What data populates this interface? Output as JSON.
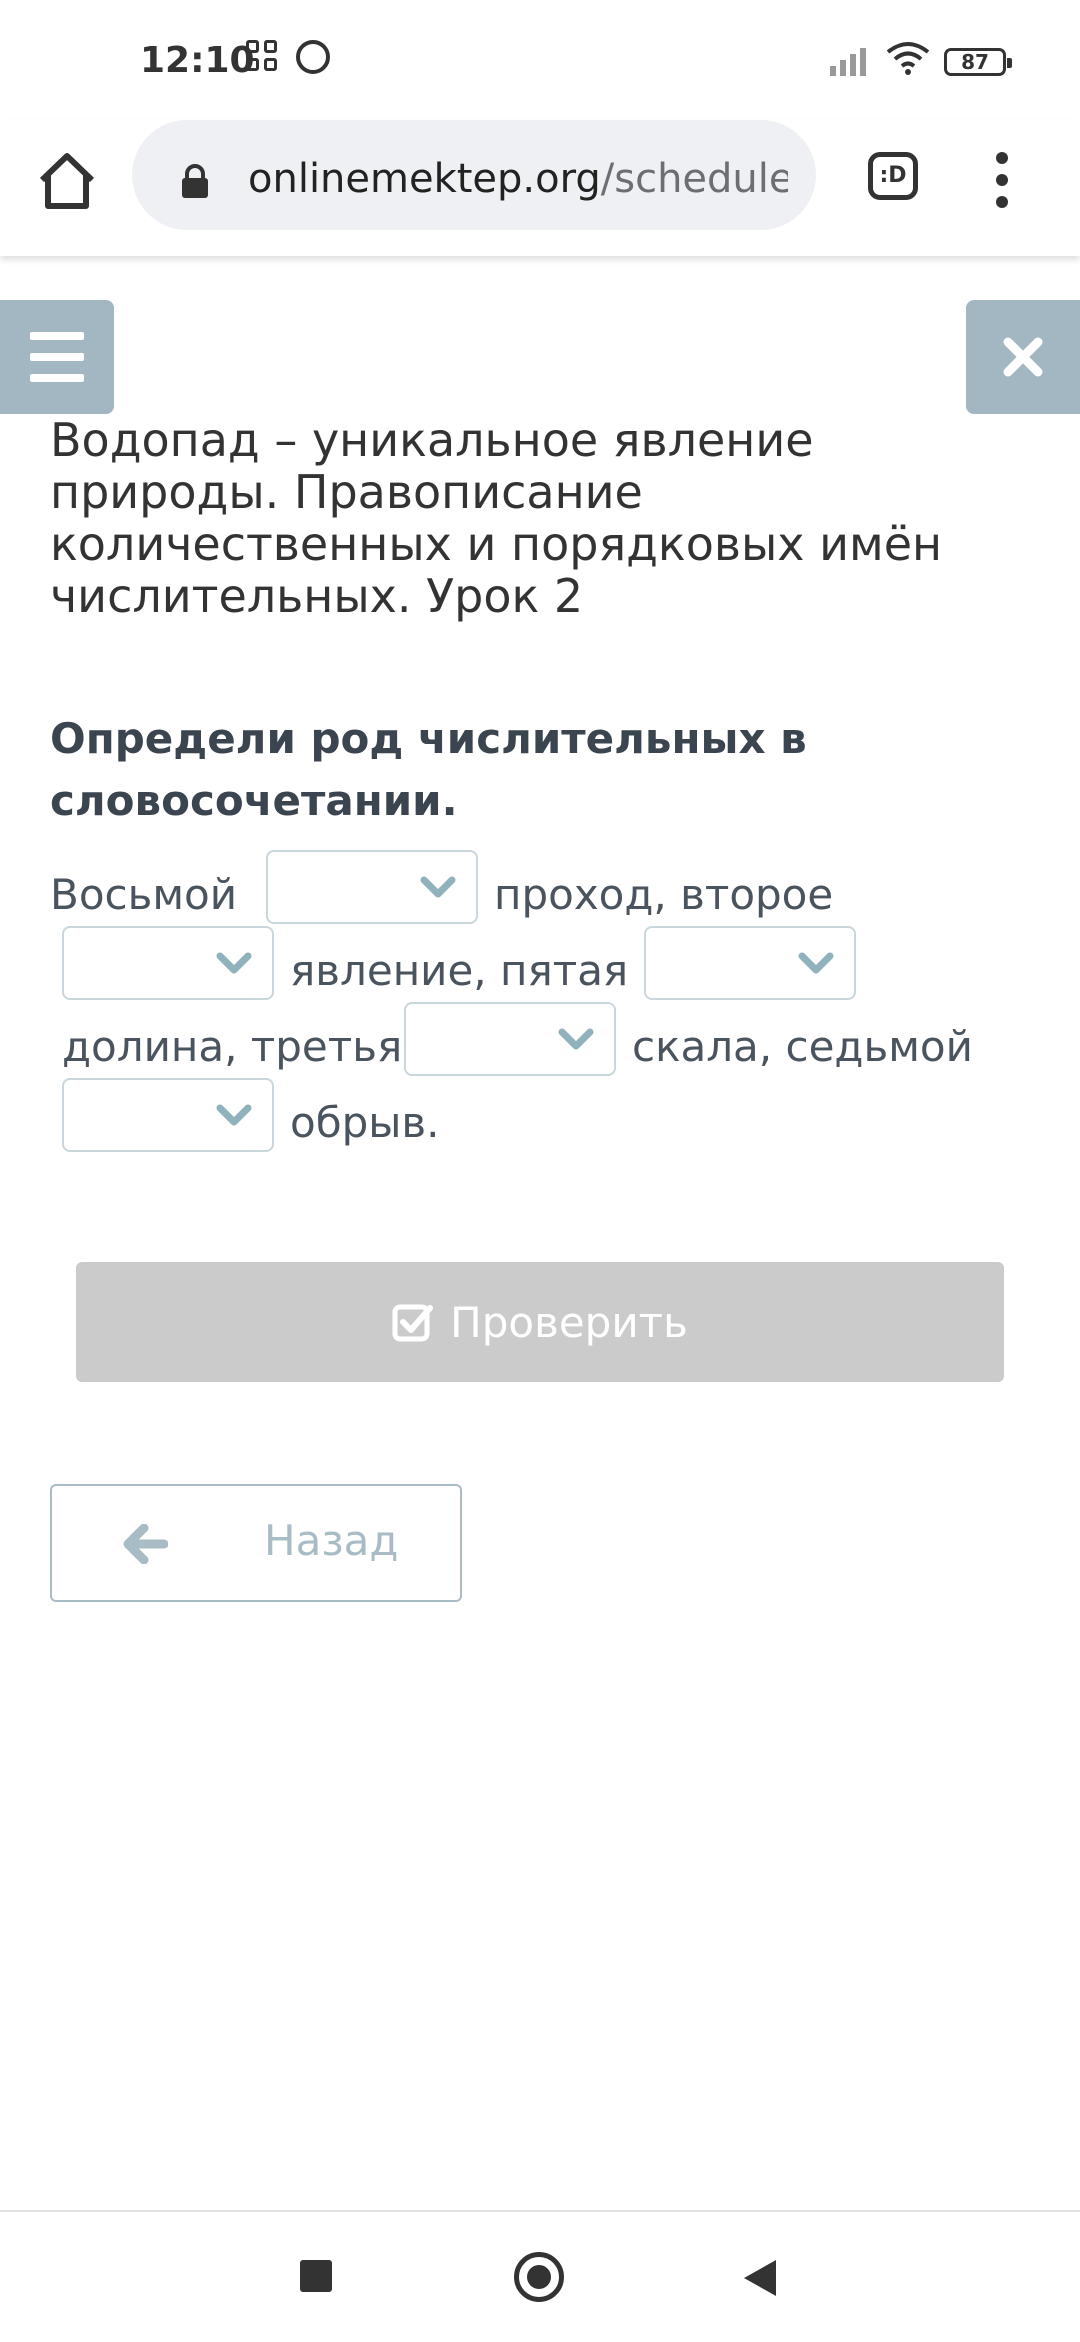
{
  "status_bar": {
    "time": "12:10",
    "battery": "87",
    "icons": [
      "grid-icon",
      "whatsapp-icon",
      "signal-icon",
      "wifi-icon",
      "battery-icon"
    ]
  },
  "browser": {
    "url_domain": "onlinemektep.org",
    "url_path": "/schedule/",
    "tab_switcher_label": ":D"
  },
  "lesson": {
    "title": "Водопад – уникальное явление природы. Правописание количественных и порядковых имён числительных. Урок 2"
  },
  "task": {
    "heading": "Определи род числительных в словосочетании.",
    "segments": {
      "s1": "Восьмой",
      "s2": "проход, второе",
      "s3": "явление, пятая",
      "s4": "долина, третья",
      "s5": "скала,  седьмой",
      "s6": "обрыв."
    },
    "dropdowns": [
      {
        "selected": ""
      },
      {
        "selected": ""
      },
      {
        "selected": ""
      },
      {
        "selected": ""
      },
      {
        "selected": ""
      }
    ]
  },
  "buttons": {
    "check": "Проверить",
    "back": "Назад"
  },
  "colors": {
    "accent_panel": "#a2b7c2",
    "check_disabled": "#cbcbcb",
    "back_border": "#a8bcc6",
    "chevron": "#8fb2bd"
  }
}
